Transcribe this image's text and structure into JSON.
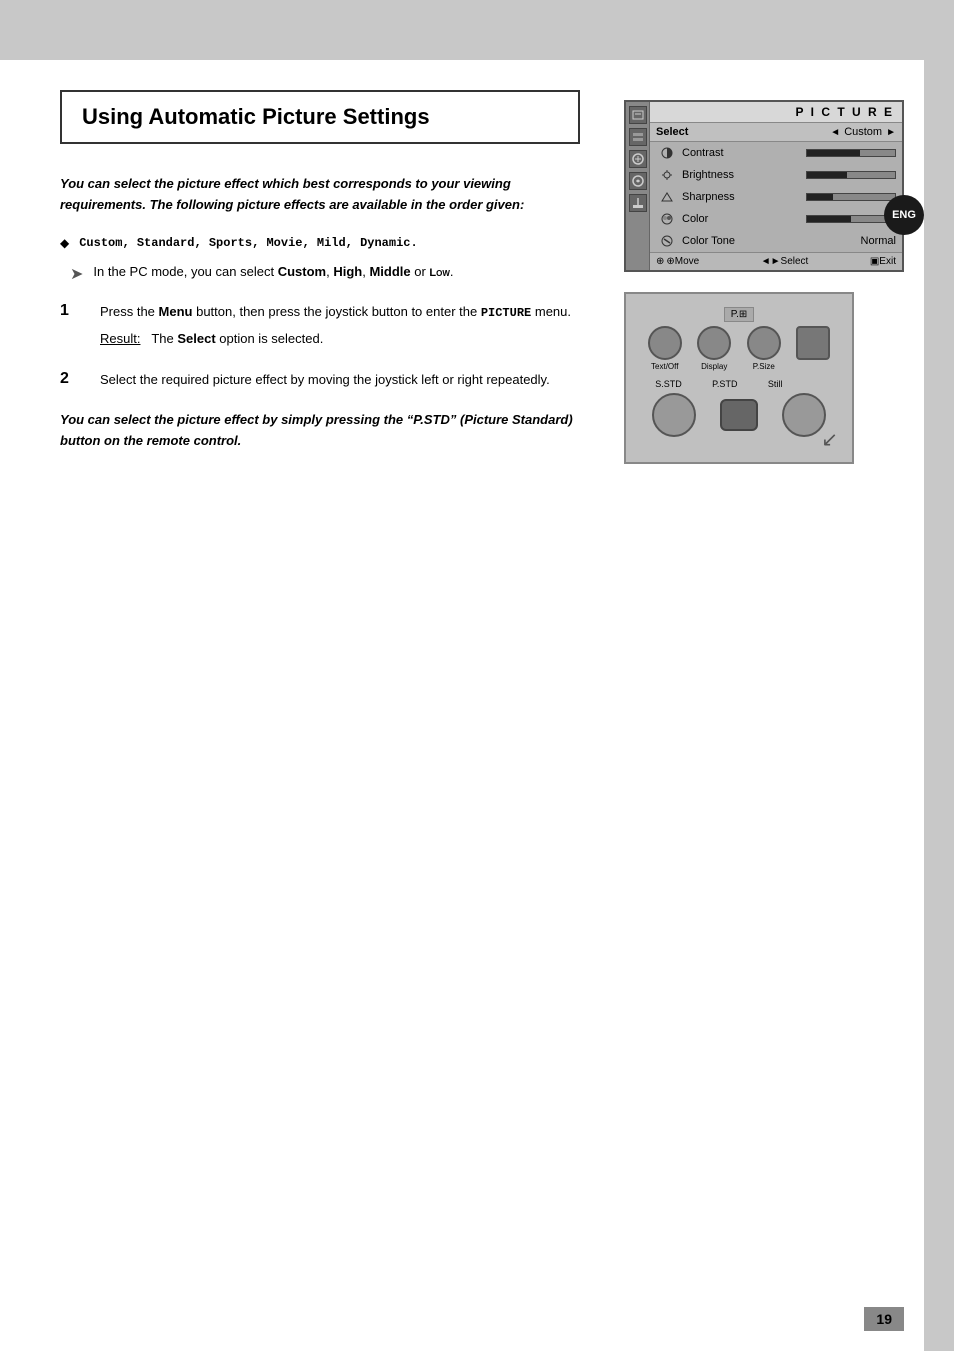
{
  "page": {
    "title": "Using Automatic Picture Settings",
    "intro_text": "You can select the picture effect which best corresponds to your viewing requirements. The following picture effects are available in the order given:",
    "bullet": {
      "text_prefix": "",
      "items": [
        "Custom, Standard, Sports, Movie, Mild, Dynamic."
      ]
    },
    "note": "In the PC mode, you can select Custom, High, Middle or Low.",
    "steps": [
      {
        "number": "1",
        "text_before": "Press the ",
        "bold_word": "Menu",
        "text_after": " button, then press the joystick button to enter the ",
        "mono_word": "PICTURE",
        "text_end": " menu.",
        "result_label": "Result:",
        "result_text": "The ",
        "result_bold": "Select",
        "result_text2": " option is selected."
      },
      {
        "number": "2",
        "text": "Select the required picture effect by moving the joystick left or right repeatedly."
      }
    ],
    "closing_italic": "You can select the picture effect by simply pressing the “P.STD” (Picture Standard) button on the remote control.",
    "page_number": "19"
  },
  "picture_panel": {
    "title": "P I C T U R E",
    "select_label": "Select",
    "select_arrow_left": "◄",
    "select_value": "Custom",
    "select_arrow_right": "►",
    "rows": [
      {
        "label": "Contrast",
        "bar_pct": 60
      },
      {
        "label": "Brightness",
        "bar_pct": 45
      },
      {
        "label": "Sharpness",
        "bar_pct": 30
      },
      {
        "label": "Color",
        "bar_pct": 50
      },
      {
        "label": "Color Tone",
        "value": "Normal"
      }
    ],
    "bottom": {
      "move": "⊕Move",
      "select": "◄►Select",
      "exit": "▣Exit"
    }
  },
  "remote": {
    "top_label": "P.⊞",
    "row1": [
      {
        "label": "Text/Off",
        "type": "round"
      },
      {
        "label": "Display",
        "type": "round"
      },
      {
        "label": "P.Size",
        "type": "round"
      },
      {
        "label": "",
        "type": "round"
      }
    ],
    "row2": [
      {
        "label": "S.STD",
        "type": "small"
      },
      {
        "label": "P.STD",
        "type": "small"
      },
      {
        "label": "Still",
        "type": "small"
      }
    ],
    "row3": [
      {
        "label": "",
        "type": "big"
      },
      {
        "label": "",
        "type": "rect"
      },
      {
        "label": "",
        "type": "big"
      }
    ]
  },
  "eng_badge": "ENG"
}
